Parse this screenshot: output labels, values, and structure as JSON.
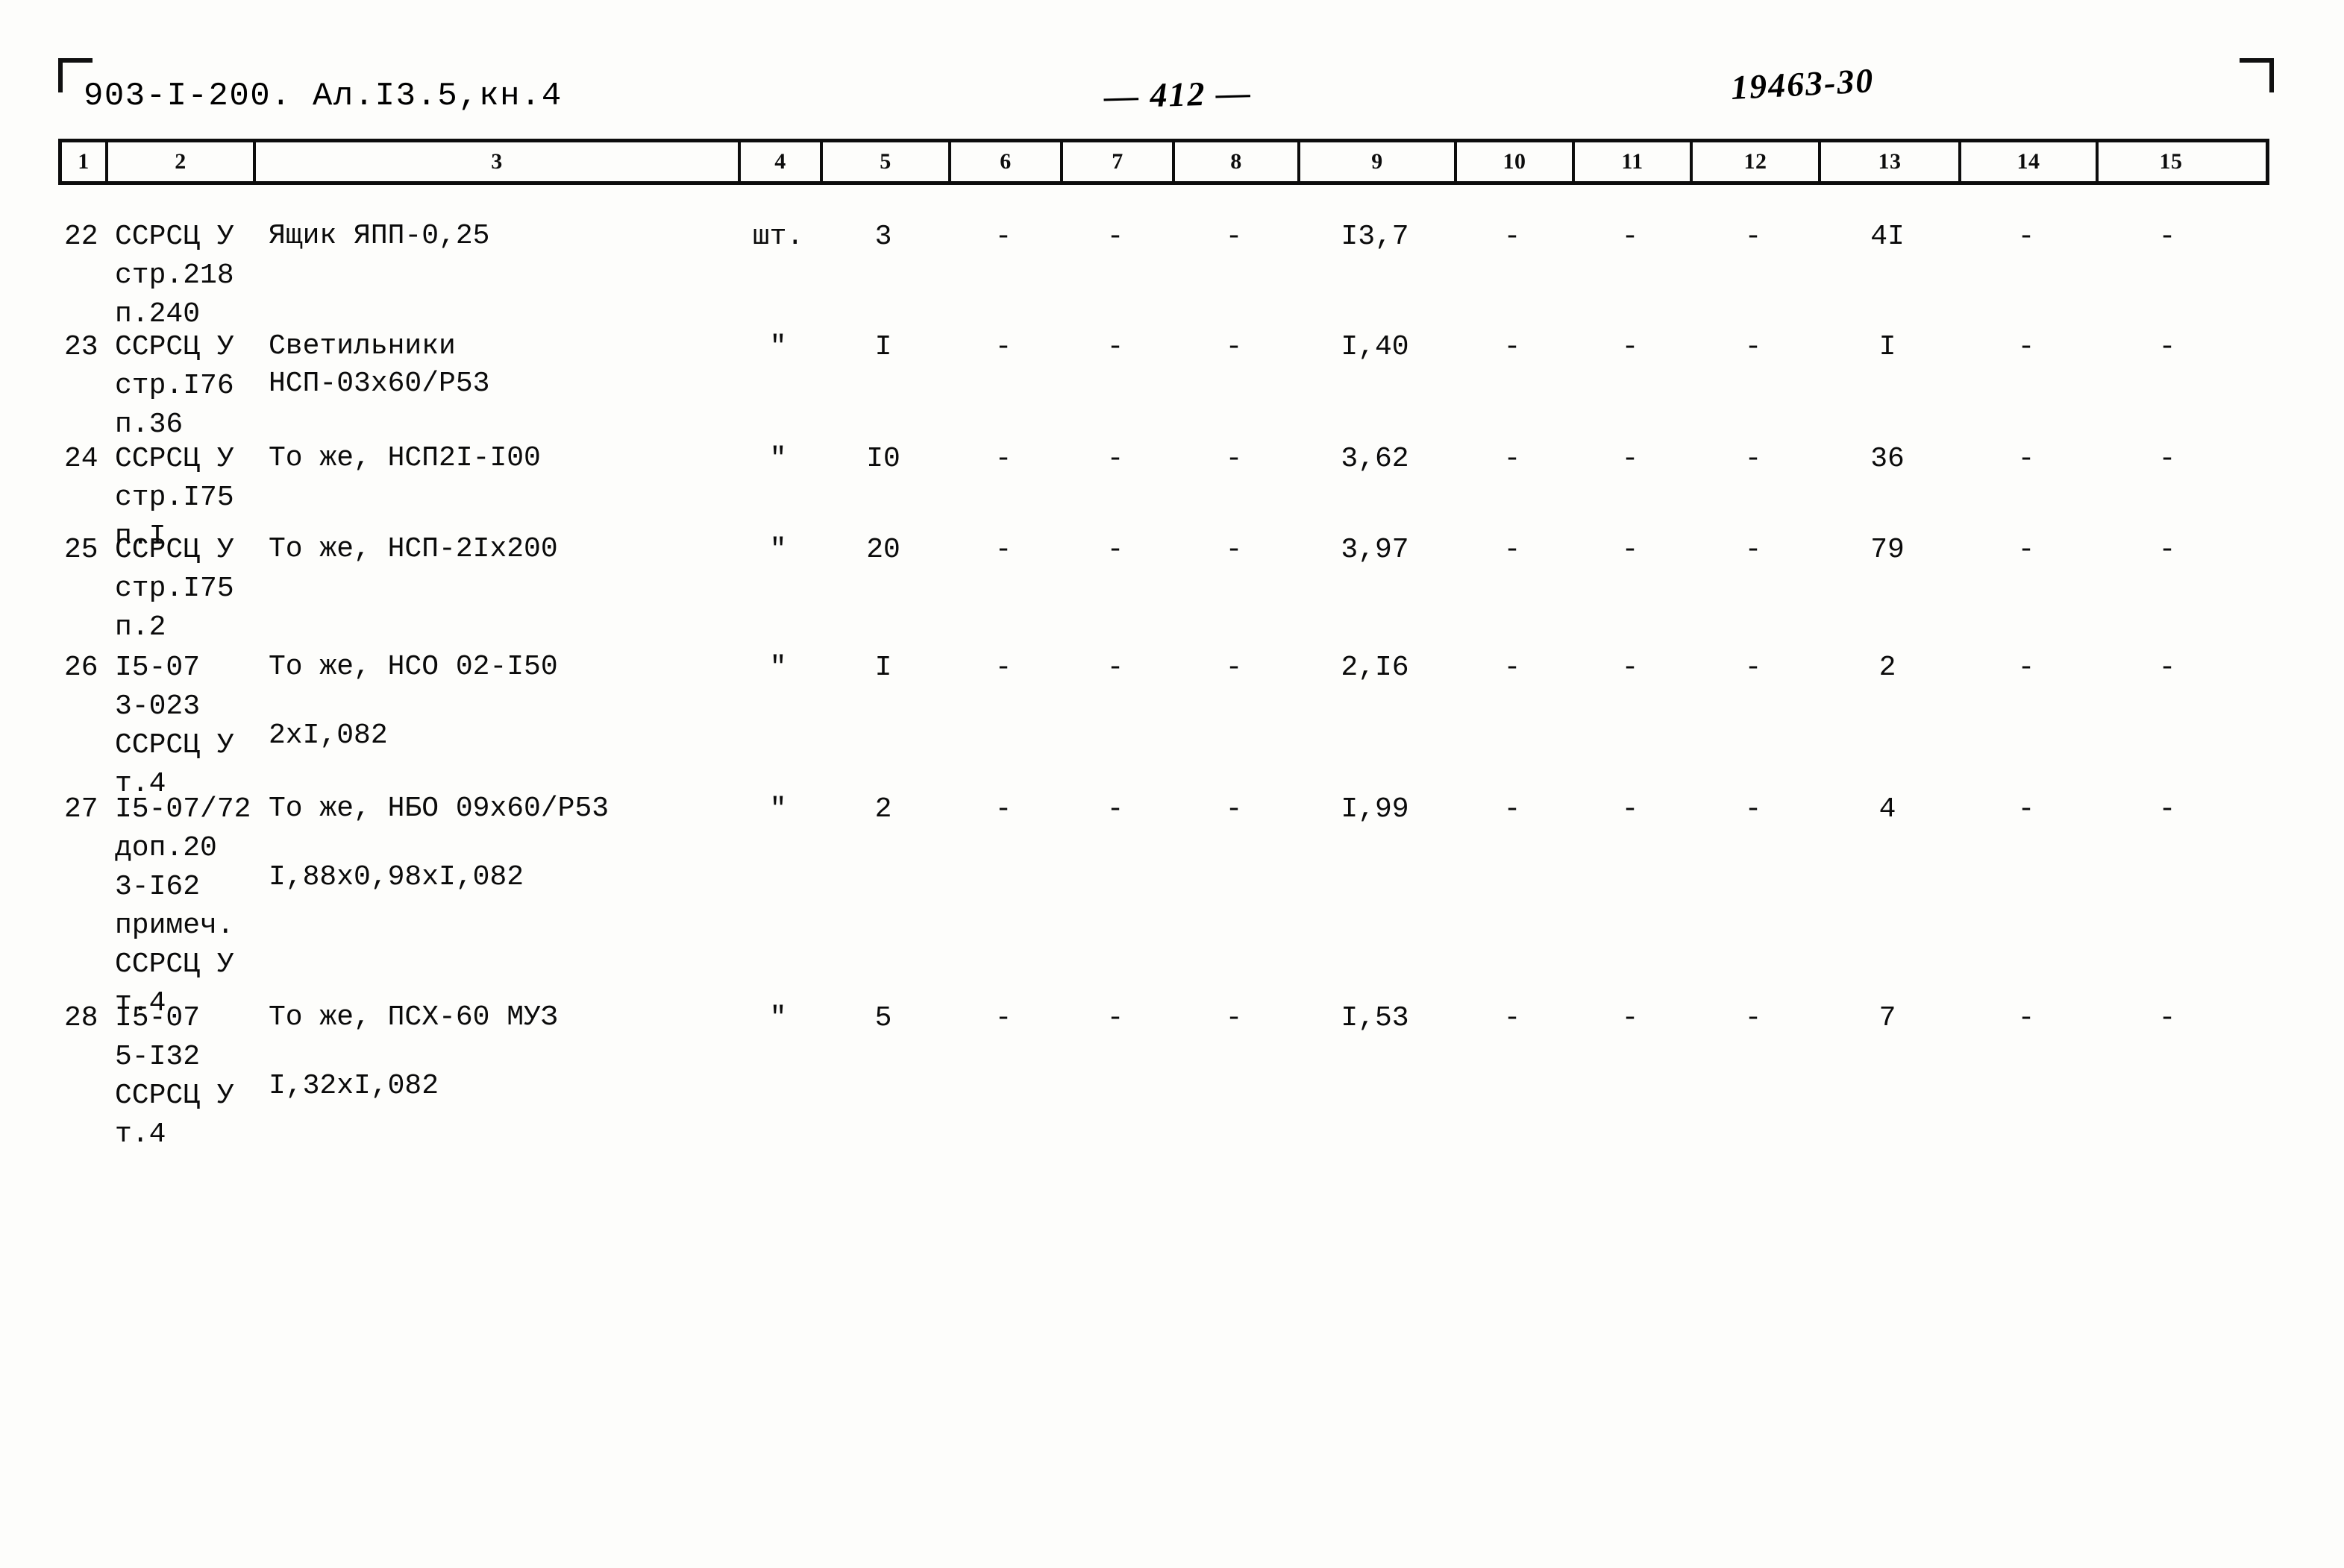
{
  "document": {
    "code": "903-I-200. Ал.I3.5,кн.4",
    "page_number": "— 412 —",
    "archive_number": "19463-30"
  },
  "table": {
    "column_headers": [
      "1",
      "2",
      "3",
      "4",
      "5",
      "6",
      "7",
      "8",
      "9",
      "10",
      "11",
      "12",
      "13",
      "14",
      "15"
    ],
    "rows": [
      {
        "num": "22",
        "justification": "ССРСЦ У\nстр.218\nп.240",
        "name": "Ящик ЯПП-0,25",
        "name_extra": "",
        "unit": "шт.",
        "c5": "3",
        "c6": "-",
        "c7": "-",
        "c8": "-",
        "c9": "I3,7",
        "c10": "-",
        "c11": "-",
        "c12": "-",
        "c13": "4I",
        "c14": "-",
        "c15": "-"
      },
      {
        "num": "23",
        "justification": "ССРСЦ У\nстр.I76\nп.36",
        "name": "Светильники\nНСП-03х60/Р53",
        "name_extra": "",
        "unit": "\"",
        "c5": "I",
        "c6": "-",
        "c7": "-",
        "c8": "-",
        "c9": "I,40",
        "c10": "-",
        "c11": "-",
        "c12": "-",
        "c13": "I",
        "c14": "-",
        "c15": "-"
      },
      {
        "num": "24",
        "justification": "ССРСЦ У\nстр.I75\nп.I",
        "name": "То же, НСП2I-I00",
        "name_extra": "",
        "unit": "\"",
        "c5": "I0",
        "c6": "-",
        "c7": "-",
        "c8": "-",
        "c9": "3,62",
        "c10": "-",
        "c11": "-",
        "c12": "-",
        "c13": "36",
        "c14": "-",
        "c15": "-"
      },
      {
        "num": "25",
        "justification": "ССРСЦ У\nстр.I75\nп.2",
        "name": "То же, НСП-2Iх200",
        "name_extra": "",
        "unit": "\"",
        "c5": "20",
        "c6": "-",
        "c7": "-",
        "c8": "-",
        "c9": "3,97",
        "c10": "-",
        "c11": "-",
        "c12": "-",
        "c13": "79",
        "c14": "-",
        "c15": "-"
      },
      {
        "num": "26",
        "justification": "I5-07\n3-023\nССРСЦ У\nт.4",
        "name": "То же, НСО 02-I50",
        "name_extra": "2хI,082",
        "unit": "\"",
        "c5": "I",
        "c6": "-",
        "c7": "-",
        "c8": "-",
        "c9": "2,I6",
        "c10": "-",
        "c11": "-",
        "c12": "-",
        "c13": "2",
        "c14": "-",
        "c15": "-"
      },
      {
        "num": "27",
        "justification": "I5-07/72\nдоп.20\n3-I62\nпримеч.\nССРСЦ У\nт.4",
        "name": "То же, НБО 09х60/Р53",
        "name_extra": "I,88х0,98хI,082",
        "unit": "\"",
        "c5": "2",
        "c6": "-",
        "c7": "-",
        "c8": "-",
        "c9": "I,99",
        "c10": "-",
        "c11": "-",
        "c12": "-",
        "c13": "4",
        "c14": "-",
        "c15": "-"
      },
      {
        "num": "28",
        "justification": "I5-07\n5-I32\nССРСЦ У\nт.4",
        "name": "То же, ПСХ-60 МУЗ",
        "name_extra": "I,32хI,082",
        "unit": "\"",
        "c5": "5",
        "c6": "-",
        "c7": "-",
        "c8": "-",
        "c9": "I,53",
        "c10": "-",
        "c11": "-",
        "c12": "-",
        "c13": "7",
        "c14": "-",
        "c15": "-"
      }
    ]
  }
}
